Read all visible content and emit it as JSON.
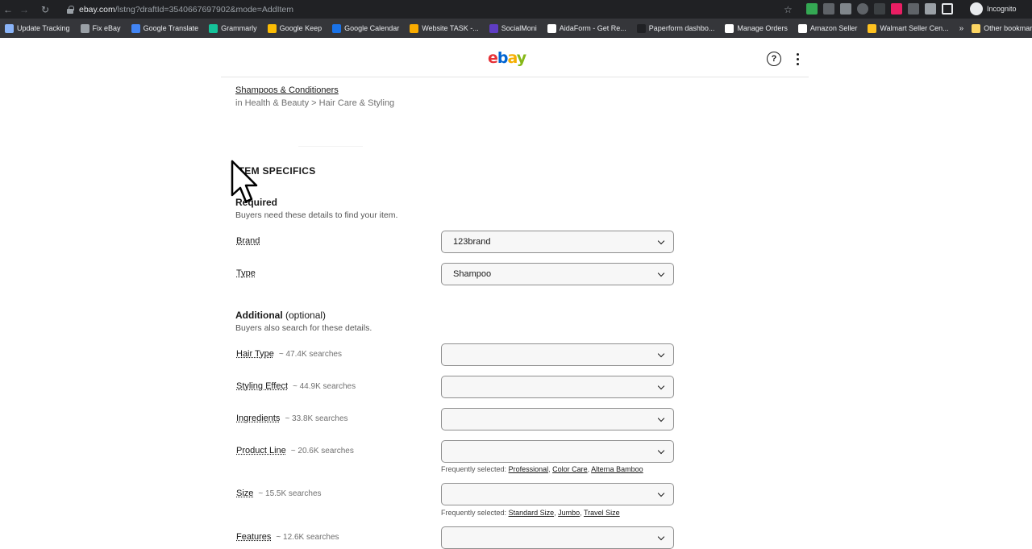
{
  "browser": {
    "url_host": "ebay.com",
    "url_rest": "/lstng?draftId=3540667697902&mode=AddItem",
    "incognito_label": "Incognito",
    "bookmarks": [
      {
        "label": "Update Tracking",
        "color": "#8ab4f8"
      },
      {
        "label": "Fix eBay",
        "color": "#9aa0a6"
      },
      {
        "label": "Google Translate",
        "color": "#4285f4"
      },
      {
        "label": "Grammarly",
        "color": "#15c39a"
      },
      {
        "label": "Google Keep",
        "color": "#fbbc04"
      },
      {
        "label": "Google Calendar",
        "color": "#1a73e8"
      },
      {
        "label": "Website TASK -...",
        "color": "#f9ab00"
      },
      {
        "label": "SocialMoni",
        "color": "#5f3dc4"
      },
      {
        "label": "AidaForm - Get Re...",
        "color": "#ffffff"
      },
      {
        "label": "Paperform dashbo...",
        "color": "#202124"
      },
      {
        "label": "Manage Orders",
        "color": "#ffffff"
      },
      {
        "label": "Amazon Seller",
        "color": "#ffffff"
      },
      {
        "label": "Walmart Seller Cen...",
        "color": "#ffc220"
      }
    ],
    "more_bookmarks": "»",
    "other_bookmarks": "Other bookmarks"
  },
  "header": {
    "logo": {
      "e": "e",
      "b": "b",
      "a": "a",
      "y": "y"
    },
    "help_symbol": "?"
  },
  "category": {
    "name": "Shampoos & Conditioners",
    "path": "in Health & Beauty > Hair Care & Styling"
  },
  "item_specifics": {
    "title": "ITEM SPECIFICS",
    "required": {
      "heading": "Required",
      "description": "Buyers need these details to find your item.",
      "fields": [
        {
          "label": "Brand",
          "value": "123brand"
        },
        {
          "label": "Type",
          "value": "Shampoo"
        }
      ]
    },
    "additional": {
      "heading": "Additional",
      "heading_suffix": " (optional)",
      "description": "Buyers also search for these details.",
      "freq_prefix": "Frequently selected:",
      "fields": [
        {
          "label": "Hair Type",
          "count": "~ 47.4K searches",
          "value": ""
        },
        {
          "label": "Styling Effect",
          "count": "~ 44.9K searches",
          "value": ""
        },
        {
          "label": "Ingredients",
          "count": "~ 33.8K searches",
          "value": ""
        },
        {
          "label": "Product Line",
          "count": "~ 20.6K searches",
          "value": "",
          "frequent": [
            "Professional",
            "Color Care",
            "Alterna Bamboo"
          ]
        },
        {
          "label": "Size",
          "count": "~ 15.5K searches",
          "value": "",
          "frequent": [
            "Standard Size",
            "Jumbo",
            "Travel Size"
          ]
        },
        {
          "label": "Features",
          "count": "~ 12.6K searches",
          "value": ""
        }
      ]
    }
  }
}
